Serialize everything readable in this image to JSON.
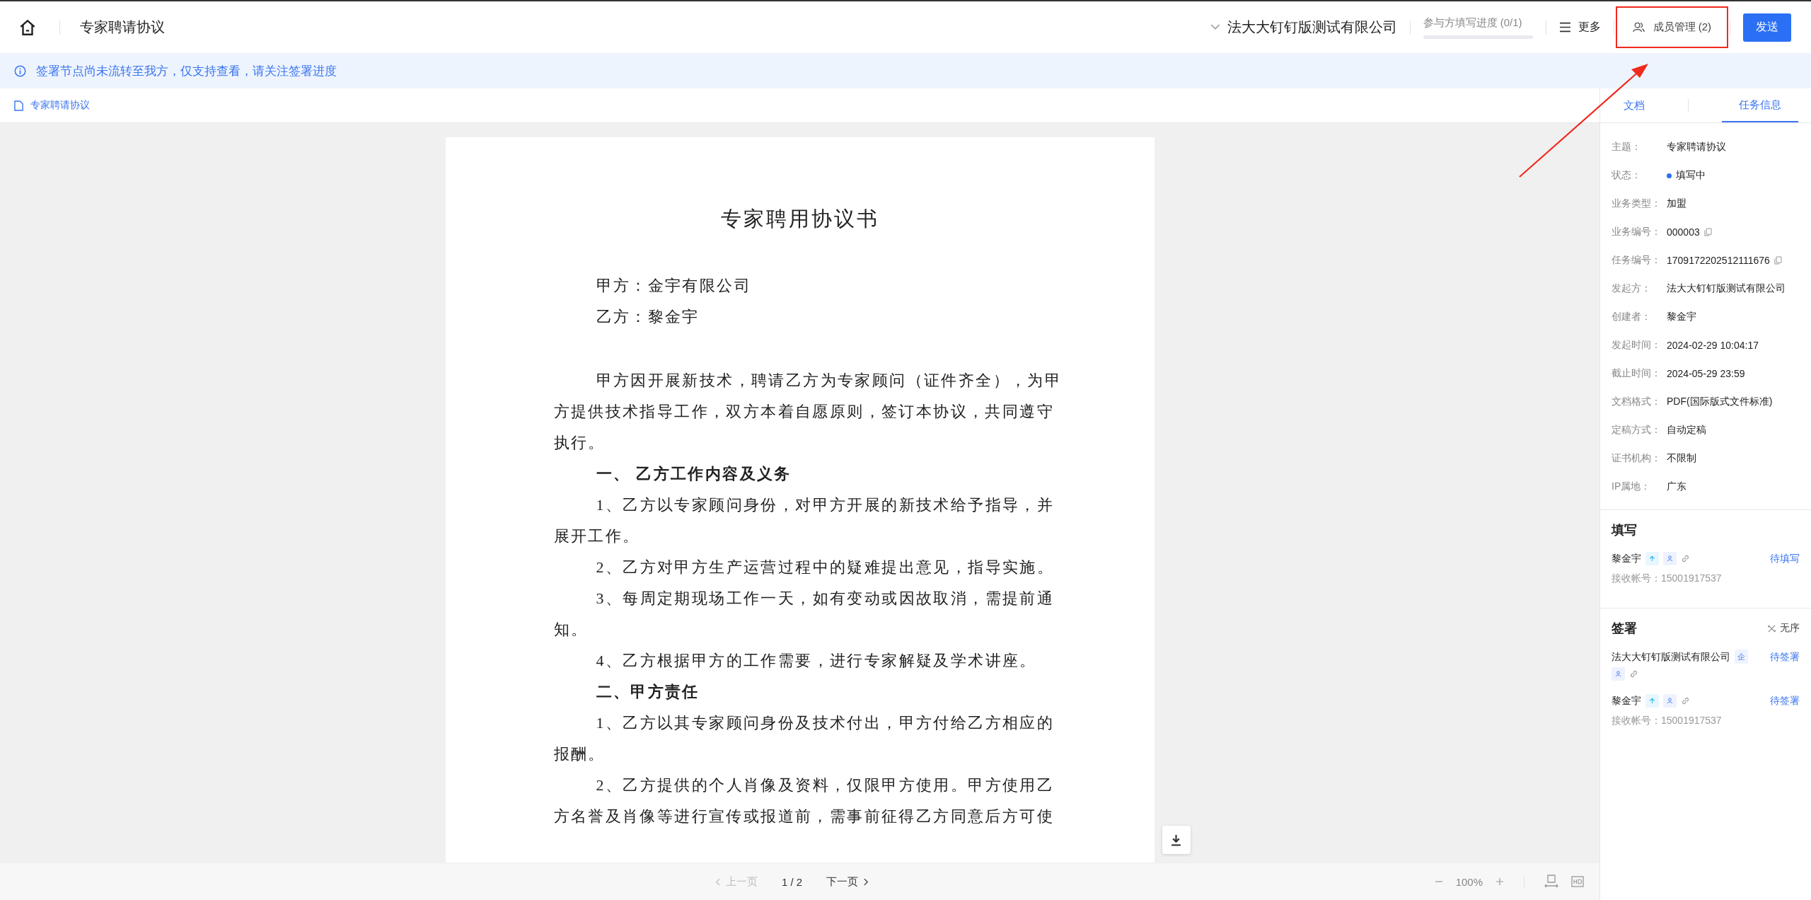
{
  "header": {
    "title": "专家聘请协议",
    "company": "法大大钉钉版测试有限公司",
    "progress": {
      "label": "参与方填写进度",
      "count": "(0/1)",
      "level": 0
    },
    "more": "更多",
    "members": {
      "label": "成员管理",
      "count": "(2)"
    },
    "send": "发送"
  },
  "banner": {
    "message": "签署节点尚未流转至我方，仅支持查看，请关注签署进度"
  },
  "doc_tabs": [
    {
      "label": "专家聘请协议",
      "selected": true
    }
  ],
  "document": {
    "title": "专家聘用协议书",
    "paragraphs": [
      {
        "kind": "party",
        "text": "甲方：金宇有限公司"
      },
      {
        "kind": "party",
        "text": "乙方：黎金宇"
      },
      {
        "kind": "body",
        "text": "甲方因开展新技术，聘请乙方为专家顾问（证件齐全），为甲方提供技术指导工作，双方本着自愿原则，签订本协议，共同遵守执行。"
      },
      {
        "kind": "heading",
        "text": "一、  乙方工作内容及义务"
      },
      {
        "kind": "body",
        "text": "1、乙方以专家顾问身份，对甲方开展的新技术给予指导，并展开工作。"
      },
      {
        "kind": "body",
        "text": "2、乙方对甲方生产运营过程中的疑难提出意见，指导实施。"
      },
      {
        "kind": "body",
        "text": "3、每周定期现场工作一天，如有变动或因故取消，需提前通知。"
      },
      {
        "kind": "body",
        "text": "4、乙方根据甲方的工作需要，进行专家解疑及学术讲座。"
      },
      {
        "kind": "heading",
        "text": "二、甲方责任"
      },
      {
        "kind": "body",
        "text": "1、乙方以其专家顾问身份及技术付出，甲方付给乙方相应的报酬。"
      },
      {
        "kind": "body",
        "text": "2、乙方提供的个人肖像及资料，仅限甲方使用。甲方使用乙方名誉及肖像等进行宣传或报道前，需事前征得乙方同意后方可使"
      }
    ]
  },
  "pager": {
    "prev": "上一页",
    "prev_disabled": true,
    "page": "1 / 2",
    "next": "下一页",
    "next_disabled": false,
    "zoom": "100%"
  },
  "panel": {
    "tabs": [
      {
        "label": "文档",
        "selected": false
      },
      {
        "label": "任务信息",
        "selected": true
      }
    ],
    "info": [
      {
        "label": "主题：",
        "value": "专家聘请协议",
        "copyable": false
      },
      {
        "label": "状态：",
        "value": "填写中",
        "color": "#2b6ff5",
        "copyable": false
      },
      {
        "label": "业务类型：",
        "value": "加盟",
        "copyable": false
      },
      {
        "label": "业务编号：",
        "value": "000003",
        "copyable": true
      },
      {
        "label": "任务编号：",
        "value": "1709172202512111676",
        "copyable": true
      },
      {
        "label": "发起方：",
        "value": "法大大钉钉版测试有限公司",
        "copyable": false
      },
      {
        "label": "创建者：",
        "value": "黎金宇",
        "copyable": false
      },
      {
        "label": "发起时间：",
        "value": "2024-02-29 10:04:17",
        "copyable": false
      },
      {
        "label": "截止时间：",
        "value": "2024-05-29 23:59",
        "copyable": false
      },
      {
        "label": "文档格式：",
        "value": "PDF(国际版式文件标准)",
        "copyable": false
      },
      {
        "label": "定稿方式：",
        "value": "自动定稿",
        "copyable": false
      },
      {
        "label": "证书机构：",
        "value": "不限制",
        "copyable": false
      },
      {
        "label": "IP属地：",
        "value": "广东",
        "copyable": false
      }
    ],
    "sections": [
      {
        "title": "填写",
        "participants": [
          {
            "name": "黎金宇",
            "icons": [
              {
                "kind": "arrow"
              },
              {
                "kind": "person"
              },
              {
                "kind": "link"
              }
            ],
            "status": "待填写",
            "account": "接收帐号：15001917537"
          }
        ]
      },
      {
        "title": "签署",
        "order": "无序",
        "participants": [
          {
            "name": "法大大钉钉版测试有限公司",
            "tag": "企",
            "icons": [
              {
                "kind": "person"
              },
              {
                "kind": "link"
              }
            ],
            "status": "待签署"
          },
          {
            "name": "黎金宇",
            "icons": [
              {
                "kind": "arrow"
              },
              {
                "kind": "person"
              },
              {
                "kind": "link"
              }
            ],
            "status": "待签署",
            "account": "接收帐号：15001917537"
          }
        ]
      }
    ]
  }
}
